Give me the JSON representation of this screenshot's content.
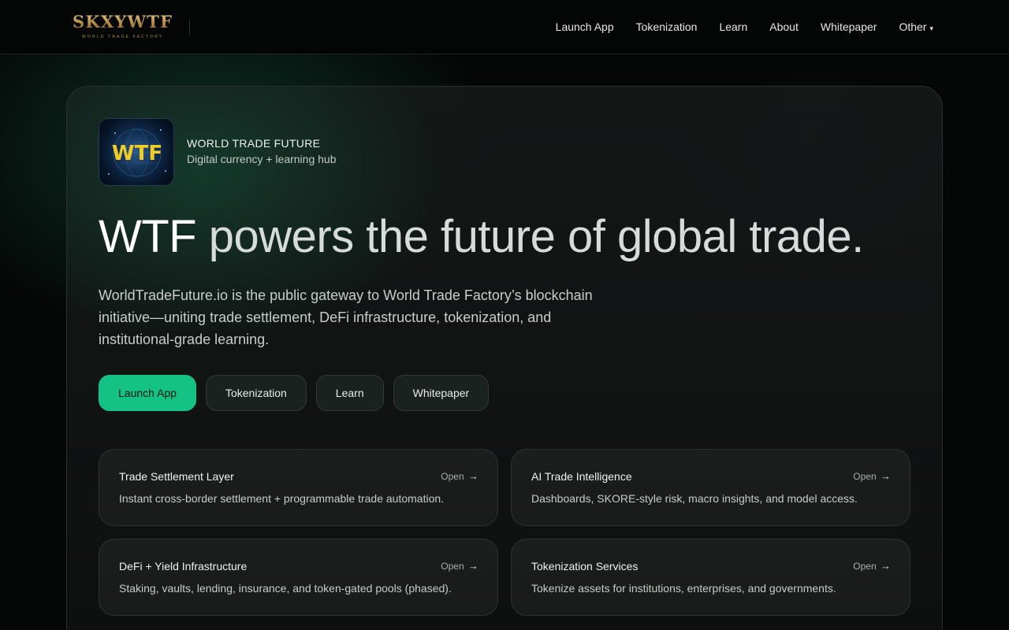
{
  "brand": {
    "wordmark": "SKXYWTF",
    "tagline": "WORLD TRADE FACTORY",
    "gold": "#b58c46"
  },
  "nav": {
    "items": [
      {
        "label": "Launch App"
      },
      {
        "label": "Tokenization"
      },
      {
        "label": "Learn"
      },
      {
        "label": "About"
      },
      {
        "label": "Whitepaper"
      },
      {
        "label": "Other",
        "caret": "▾"
      }
    ]
  },
  "hero": {
    "logo_text": "WTF",
    "org_name": "WORLD TRADE FUTURE",
    "org_tagline": "Digital currency + learning hub",
    "headline_strong": "WTF",
    "headline_rest": " powers the future of global trade.",
    "lead": "WorldTradeFuture.io is the public gateway to World Trade Factory’s blockchain initiative—uniting trade settlement, DeFi infrastructure, tokenization, and institutional-grade learning.",
    "accent": "#14c285",
    "buttons": [
      {
        "label": "Launch App",
        "primary": true
      },
      {
        "label": "Tokenization"
      },
      {
        "label": "Learn"
      },
      {
        "label": "Whitepaper"
      }
    ]
  },
  "tiles": [
    {
      "title": "Trade Settlement Layer",
      "open": "Open",
      "arrow": "→",
      "desc": "Instant cross-border settlement + programmable trade automation."
    },
    {
      "title": "AI Trade Intelligence",
      "open": "Open",
      "arrow": "→",
      "desc": "Dashboards, SKORE-style risk, macro insights, and model access."
    },
    {
      "title": "DeFi + Yield Infrastructure",
      "open": "Open",
      "arrow": "→",
      "desc": "Staking, vaults, lending, insurance, and token-gated pools (phased)."
    },
    {
      "title": "Tokenization Services",
      "open": "Open",
      "arrow": "→",
      "desc": "Tokenize assets for institutions, enterprises, and governments."
    }
  ]
}
